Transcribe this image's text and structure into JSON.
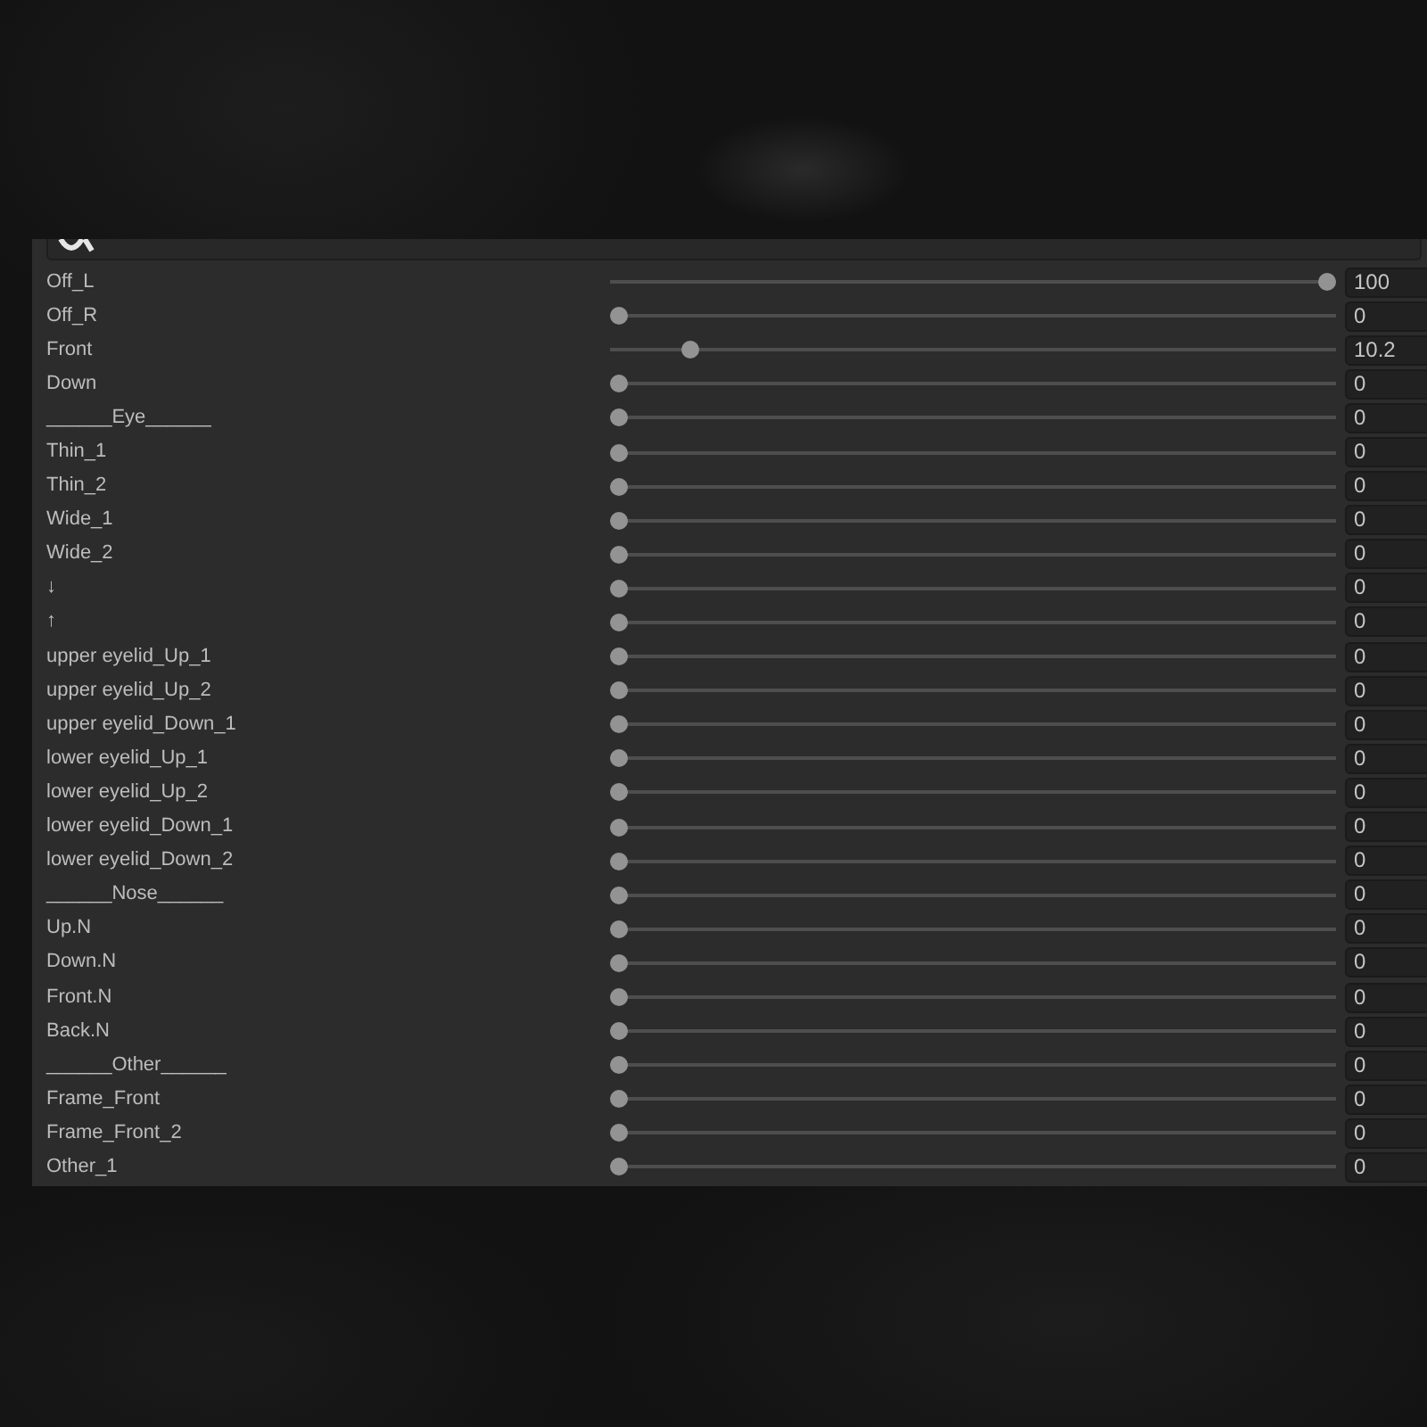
{
  "sliders": [
    {
      "label": "Off_L",
      "level": 1,
      "value": "100"
    },
    {
      "label": "Off_R",
      "level": 0,
      "value": "0"
    },
    {
      "label": "Front",
      "level": 0.102,
      "value": "10.2"
    },
    {
      "label": "Down",
      "level": 0,
      "value": "0"
    },
    {
      "label": "______Eye______",
      "level": 0,
      "value": "0"
    },
    {
      "label": "Thin_1",
      "level": 0,
      "value": "0"
    },
    {
      "label": "Thin_2",
      "level": 0,
      "value": "0"
    },
    {
      "label": "Wide_1",
      "level": 0,
      "value": "0"
    },
    {
      "label": "Wide_2",
      "level": 0,
      "value": "0"
    },
    {
      "label": "↓",
      "level": 0,
      "value": "0"
    },
    {
      "label": "↑",
      "level": 0,
      "value": "0"
    },
    {
      "label": "upper eyelid_Up_1",
      "level": 0,
      "value": "0"
    },
    {
      "label": "upper eyelid_Up_2",
      "level": 0,
      "value": "0"
    },
    {
      "label": "upper eyelid_Down_1",
      "level": 0,
      "value": "0"
    },
    {
      "label": "lower eyelid_Up_1",
      "level": 0,
      "value": "0"
    },
    {
      "label": "lower eyelid_Up_2",
      "level": 0,
      "value": "0"
    },
    {
      "label": "lower eyelid_Down_1",
      "level": 0,
      "value": "0"
    },
    {
      "label": "lower eyelid_Down_2",
      "level": 0,
      "value": "0"
    },
    {
      "label": "______Nose______",
      "level": 0,
      "value": "0"
    },
    {
      "label": "Up.N",
      "level": 0,
      "value": "0"
    },
    {
      "label": "Down.N",
      "level": 0,
      "value": "0"
    },
    {
      "label": "Front.N",
      "level": 0,
      "value": "0"
    },
    {
      "label": "Back.N",
      "level": 0,
      "value": "0"
    },
    {
      "label": "______Other______",
      "level": 0,
      "value": "0"
    },
    {
      "label": "Frame_Front",
      "level": 0,
      "value": "0"
    },
    {
      "label": "Frame_Front_2",
      "level": 0,
      "value": "0"
    },
    {
      "label": "Other_1",
      "level": 0,
      "value": "0"
    }
  ]
}
